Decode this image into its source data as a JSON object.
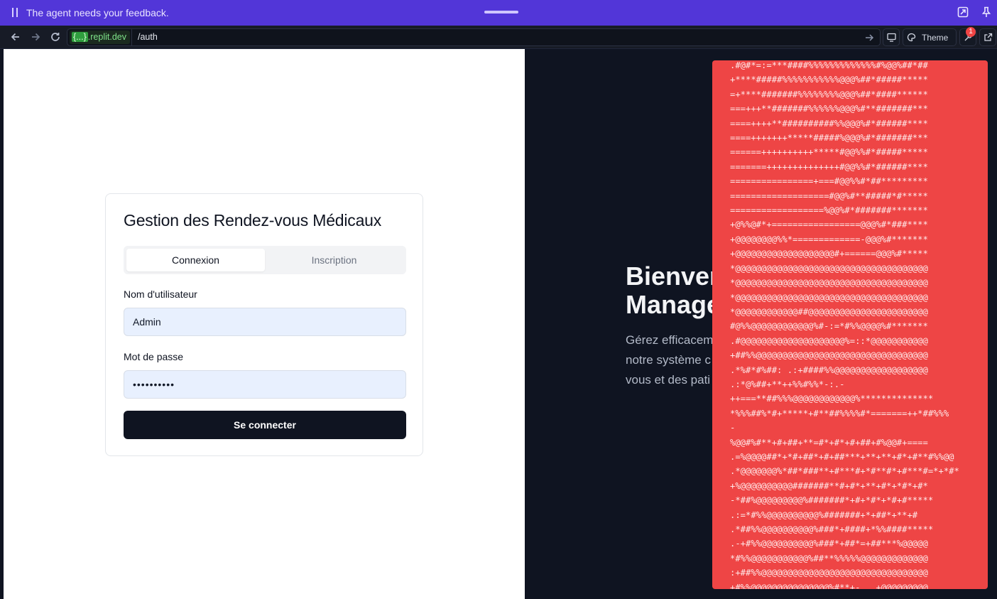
{
  "banner": {
    "message": "The agent needs your feedback."
  },
  "browser": {
    "domain_badge": "{...}",
    "domain_text": ".replit.dev",
    "path": "/auth",
    "theme_label": "Theme",
    "notification_count": "1"
  },
  "login_card": {
    "title": "Gestion des Rendez-vous Médicaux",
    "tabs": [
      {
        "label": "Connexion",
        "active": true
      },
      {
        "label": "Inscription",
        "active": false
      }
    ],
    "username_label": "Nom d'utilisateur",
    "username_value": "Admin",
    "password_label": "Mot de passe",
    "password_value": "••••••••••",
    "submit_label": "Se connecter"
  },
  "hero": {
    "title_line1": "Bienver",
    "title_line2": "Manage",
    "subtitle_line1": "Gérez efficacem",
    "subtitle_line2": "notre système c",
    "subtitle_line3": "vous et des pati"
  },
  "overlay": {
    "lines": [
      ".#@#*=:=***####%%%%%%%%%%%%%#%@@%##*##",
      "+****#####%%%%%%%%%%%@@@%##*#####*****",
      "=+****#######%%%%%%%%@@@%##*####******",
      "===+++**#######%%%%%%@@@%#**#######***",
      "====++++**##########%%@@@%#*######****",
      "====+++++++*****#####%@@@%#*#######***",
      "======++++++++++*****#@@%%#*#####*****",
      "=======++++++++++++++#@@%%#*######****",
      "================+===#@@%%#*##*********",
      "===================#@@%#**#####*#*****",
      "==================%@@%#*#######*******",
      "+@%%@#*+=================@@@%#*###****",
      "+@@@@@@@@%%*=============-@@@%#*******",
      "+@@@@@@@@@@@@@@@@@@@#+======@@@%#*****",
      "*@@@@@@@@@@@@@@@@@@@@@@@@@@@@@@@@@@@@@",
      "*@@@@@@@@@@@@@@@@@@@@@@@@@@@@@@@@@@@@@",
      "*@@@@@@@@@@@@@@@@@@@@@@@@@@@@@@@@@@@@@",
      "*@@@@@@@@@@@@##@@@@@@@@@@@@@@@@@@@@@@@",
      "#@%%@@@@@@@@@@@@%#-:=*#%%@@@@%#*******",
      ".#@@@@@@@@@@@@@@@@@@@@%=::*@@@@@@@@@@@",
      "+##%%@@@@@@@@@@@@@@@@@@@@@@@@@@@@@@@@@",
      ".*%#*#%##: .:+####%%@@@@@@@@@@@@@@@@@@",
      ".:*@%##+**++%%#%%*-:.-",
      "++===**##%%%@@@@@@@@@@@@%**************",
      "*%%%##%*#+*****+#**##%%%%#*=======++*##%%%",
      "-",
      "%@@#%#**+#+##+**=#*+#*+#+##+#%@@#+====",
      ".=%@@@@##*+*#+##*+#+##***+**+**+#*+#**#%%@@",
      ".*@@@@@@@%*##*###**+#***#+*#**#*+#***#=*+*#*",
      "+%@@@@@@@@@@#######**#+#*+**+#*+*#*+#*",
      "-*##%@@@@@@@@@%#######*+#+*#*+*#+#*****",
      ".:=*#%%@@@@@@@@@@%#######+*+##*+**+#",
      ".*##%%@@@@@@@@@@%###*+####+*%%####*****",
      ".-+#%%@@@@@@@@@@%###*+##*=+##***%@@@@@",
      "*#%%@@@@@@@@@@@%##**%%%%%@@@@@@@@@@@@@",
      ":+##%%@@@@@@@@@@@@@@@@@@@@@@@@@@@@@@@@",
      "+#%%@@@@@@@@@@@@@@@%#**+-. .+@@@@@@@@@",
      ".*##%%@@@@@@@@@@%#**+-. .%@@@@@@@@@@@@"
    ]
  }
}
